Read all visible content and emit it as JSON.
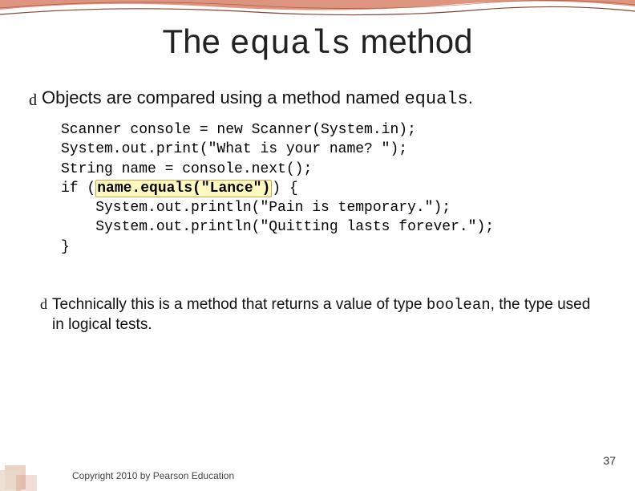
{
  "title": {
    "pre": "The ",
    "code": "equals",
    "post": " method"
  },
  "bullet1": {
    "icon": "d",
    "pre": "Objects are compared using a method named ",
    "code": "equals",
    "post": "."
  },
  "code": {
    "l1": "Scanner console = new Scanner(System.in);",
    "l2": "System.out.print(\"What is your name? \");",
    "l3": "String name = console.next();",
    "l4a": "if (",
    "l4hl": "name.equals(\"Lance\")",
    "l4b": ") {",
    "l5": "    System.out.println(\"Pain is temporary.\");",
    "l6": "    System.out.println(\"Quitting lasts forever.\");",
    "l7": "}"
  },
  "bullet2": {
    "icon": "d",
    "pre": "Technically this is a method that returns a value of type ",
    "code": "boolean",
    "post": ", the type used in logical tests."
  },
  "pageNumber": "37",
  "copyright": "Copyright 2010 by Pearson Education"
}
